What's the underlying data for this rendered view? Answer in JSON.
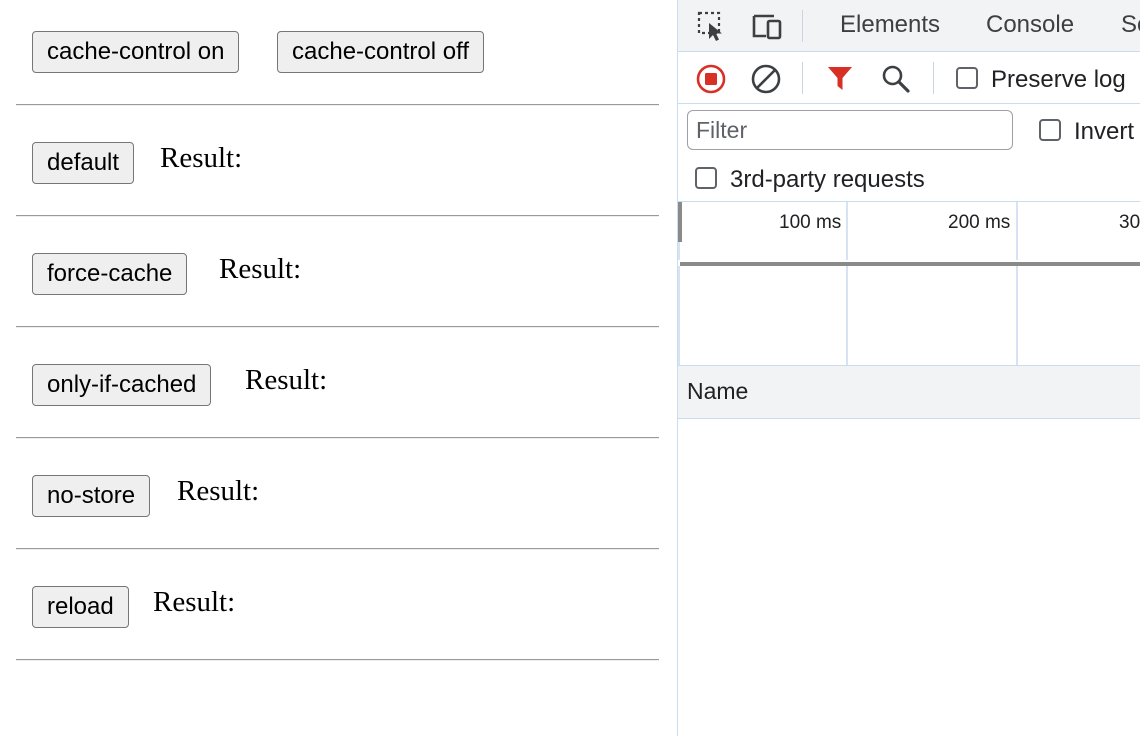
{
  "page": {
    "top_buttons": [
      "cache-control on",
      "cache-control off"
    ],
    "rows": [
      {
        "button": "default",
        "result_label": "Result:"
      },
      {
        "button": "force-cache",
        "result_label": "Result:"
      },
      {
        "button": "only-if-cached",
        "result_label": "Result:"
      },
      {
        "button": "no-store",
        "result_label": "Result:"
      },
      {
        "button": "reload",
        "result_label": "Result:"
      }
    ]
  },
  "devtools": {
    "tabs": [
      "Elements",
      "Console",
      "So"
    ],
    "icons": {
      "inspect": "inspect-element-icon",
      "device": "device-toolbar-icon",
      "record": "record-icon",
      "clear": "clear-icon",
      "filter": "filter-icon",
      "search": "search-icon"
    },
    "colors": {
      "record": "#d93025",
      "filter": "#d93025",
      "accent": "#1a73e8"
    },
    "preserve_log": {
      "label": "Preserve log",
      "checked": false
    },
    "filter": {
      "placeholder": "Filter",
      "value": ""
    },
    "invert": {
      "label": "Invert",
      "checked": false
    },
    "third_party": {
      "label": "3rd-party requests",
      "checked": false
    },
    "timeline_ticks": [
      "100 ms",
      "200 ms",
      "30"
    ],
    "table": {
      "name_header": "Name"
    }
  }
}
